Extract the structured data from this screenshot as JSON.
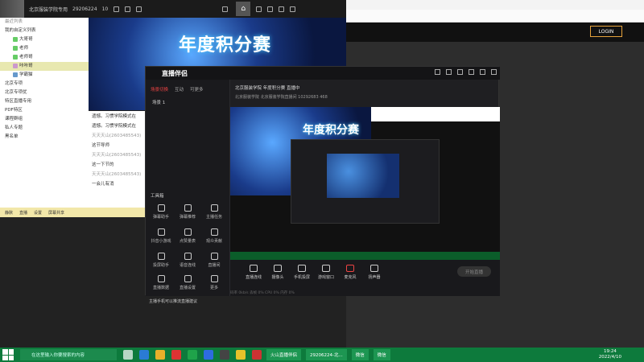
{
  "desktop": {
    "login_label": "LOGIN"
  },
  "host_bar": {
    "title": "北京服装学院专用",
    "id_text": "29206224",
    "count": "10"
  },
  "left_panel": {
    "header": "最近列表",
    "items": [
      "我的自定义列表",
      "大哥哥",
      "老师",
      "老师哥",
      "咔咔哥",
      "学霸猫",
      "北京专项",
      "北京专项优",
      "特区直播专用",
      "PDF特区",
      "课程群组",
      "私人专题",
      "黑名单"
    ],
    "selected_index": 4
  },
  "chat_lines": [
    "遗憾。习惯学院模式在",
    "遗憾。习惯学院模式在",
    "天天天山(2603485543)",
    "这节导师",
    "天天天山(2603485543)",
    "这一下节的",
    "天天天山(2603485543)",
    "一会儿有消"
  ],
  "left_toolbar": [
    "静默",
    "直播",
    "设置",
    "屏幕共享"
  ],
  "banner": {
    "title": "年度积分赛"
  },
  "app": {
    "logo": "直播伴侣",
    "scene_tabs": [
      "场景切换",
      "互动",
      "可更多"
    ],
    "scene_item": "场景 1",
    "tools_header": "工具箱",
    "tools": [
      "弹幕助手",
      "弹幕推荐",
      "主播任务",
      "抖音小游戏",
      "点赞量表",
      "观众贡献",
      "投屏助手",
      "语音连线",
      "直播间",
      "直播数据",
      "直播设置",
      "更多"
    ],
    "room_title": "北京服装学院 年度积分赛 直播中",
    "room_info": "北京服装学院  北京服装学院直播间  10292683  468",
    "bottom_tools": [
      "直播连线",
      "摄像头",
      "手机投屏",
      "游戏窗口",
      "麦克风",
      "扬声器"
    ],
    "start_label": "开始直播",
    "hint": "主播手机可以推流直播建议",
    "status": "码率 0kb/s   丢帧 0%   CPU 0%   内存 0%"
  },
  "taskbar": {
    "search_placeholder": "在这里输入你要搜索的内容",
    "tasks": [
      "火山直播伴侣",
      "29206224-北...",
      "微信",
      "微信"
    ],
    "time": "19:24",
    "date": "2022/4/10"
  },
  "colors": {
    "taskbar": "#0d7a3c",
    "accent": "#e6a23c",
    "app_bg": "#1f1f22"
  }
}
